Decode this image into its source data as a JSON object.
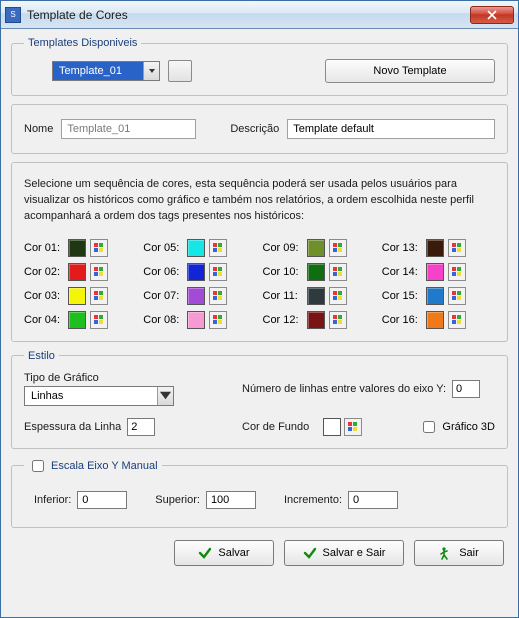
{
  "window": {
    "title": "Template de Cores"
  },
  "groups": {
    "templates_disponiveis": "Templates Disponiveis",
    "estilo": "Estilo",
    "escala": "Escala Eixo Y Manual"
  },
  "templates": {
    "selected": "Template_01",
    "novo_btn": "Novo Template"
  },
  "nome": {
    "label": "Nome",
    "value": "Template_01"
  },
  "descricao": {
    "label": "Descrição",
    "value": "Template default"
  },
  "instrucao": "Selecione um sequência de cores, esta sequência poderá ser usada pelos usuários para visualizar os históricos como gráfico e também nos relatórios, a ordem escolhida neste perfil acompanhará a ordem dos tags presentes nos históricos:",
  "cores": [
    {
      "label": "Cor 01:",
      "hex": "#1f3813"
    },
    {
      "label": "Cor 02:",
      "hex": "#e31b1b"
    },
    {
      "label": "Cor 03:",
      "hex": "#f5f50a"
    },
    {
      "label": "Cor 04:",
      "hex": "#1fbf1f"
    },
    {
      "label": "Cor 05:",
      "hex": "#17e6e6"
    },
    {
      "label": "Cor 06:",
      "hex": "#1224d6"
    },
    {
      "label": "Cor 07:",
      "hex": "#a44bd6"
    },
    {
      "label": "Cor 08:",
      "hex": "#f59ad2"
    },
    {
      "label": "Cor 09:",
      "hex": "#6f8f2a"
    },
    {
      "label": "Cor 10:",
      "hex": "#0f6e0f"
    },
    {
      "label": "Cor 11:",
      "hex": "#2f3a3f"
    },
    {
      "label": "Cor 12:",
      "hex": "#7a1414"
    },
    {
      "label": "Cor 13:",
      "hex": "#3a1a0a"
    },
    {
      "label": "Cor 14:",
      "hex": "#f542c8"
    },
    {
      "label": "Cor 15:",
      "hex": "#1f7acc"
    },
    {
      "label": "Cor 16:",
      "hex": "#f07a1a"
    }
  ],
  "estilo": {
    "tipo_label": "Tipo de Gráfico",
    "tipo_value": "Linhas",
    "num_linhas_label": "Número de linhas entre valores do eixo Y:",
    "num_linhas_value": "0",
    "espessura_label": "Espessura da Linha",
    "espessura_value": "2",
    "cor_fundo_label": "Cor de Fundo",
    "cor_fundo_hex": "#ffffff",
    "grafico3d_label": "Gráfico 3D",
    "grafico3d_checked": false
  },
  "escala": {
    "checked": false,
    "inferior_label": "Inferior:",
    "inferior_value": "0",
    "superior_label": "Superior:",
    "superior_value": "100",
    "incremento_label": "Incremento:",
    "incremento_value": "0"
  },
  "buttons": {
    "salvar": "Salvar",
    "salvar_sair": "Salvar e Sair",
    "sair": "Sair"
  }
}
